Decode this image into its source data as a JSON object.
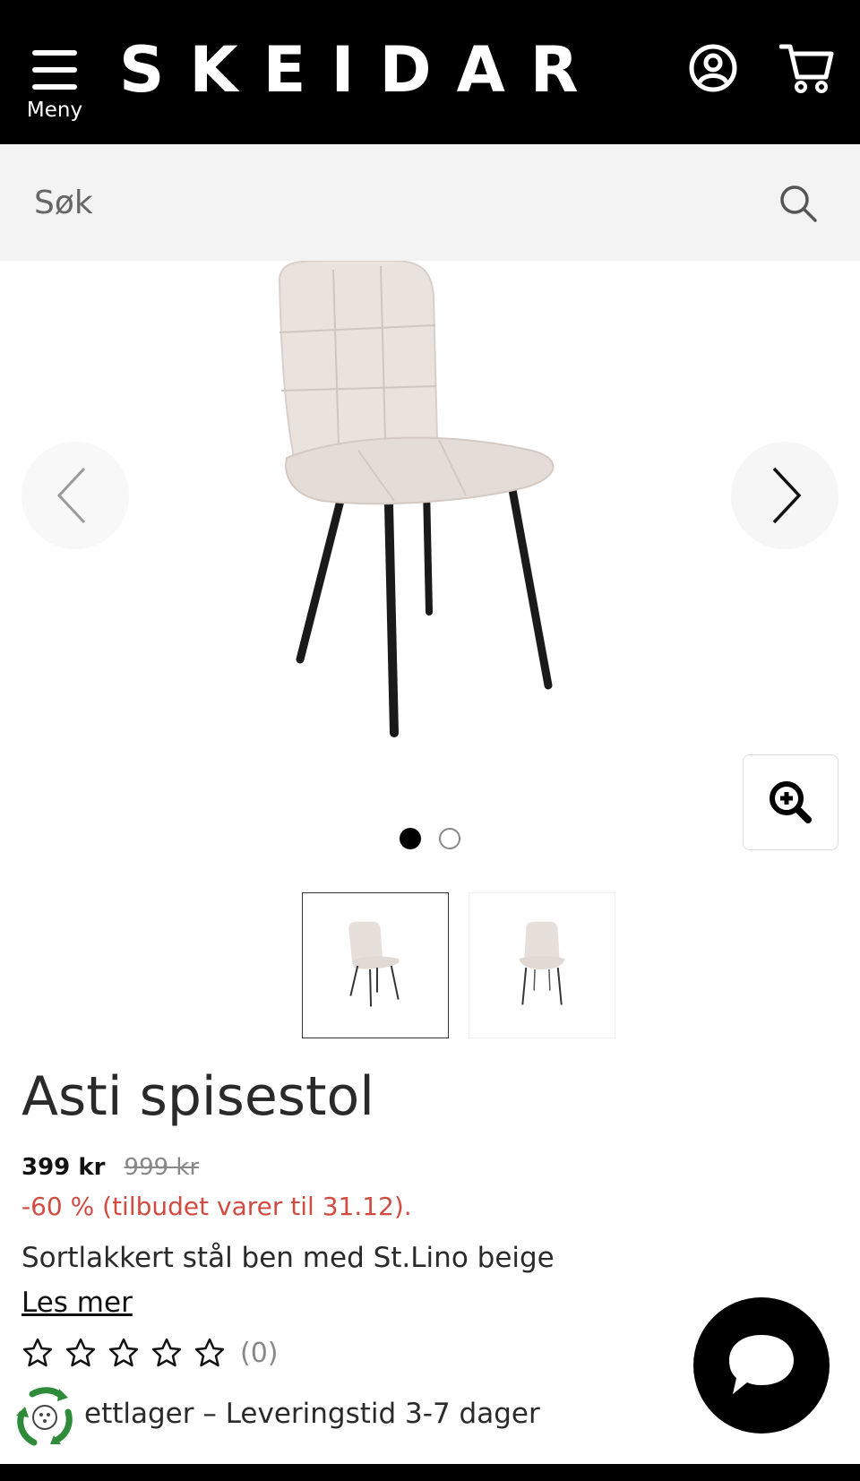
{
  "header": {
    "menu_label": "Meny",
    "logo_text": "SKEIDAR",
    "icons": [
      "hamburger-icon",
      "account-icon",
      "cart-icon"
    ]
  },
  "search": {
    "placeholder": "Søk",
    "icon": "search-icon"
  },
  "gallery": {
    "image_alt": "Asti spisestol",
    "slide_count": 2,
    "active_slide": 1,
    "icons": [
      "chevron-left-icon",
      "chevron-right-icon",
      "zoom-in-icon"
    ]
  },
  "product": {
    "title": "Asti spisestol",
    "price": "399 kr",
    "old_price": "999 kr",
    "discount": "-60 % (tilbudet varer til 31.12).",
    "description": "Sortlakkert stål ben med St.Lino beige",
    "read_more": "Les mer",
    "rating": 0,
    "rating_max": 5,
    "review_count": "(0)",
    "stock": "ettlager – Leveringstid 3-7 dager"
  },
  "colors": {
    "header_bg": "#000000",
    "search_bg": "#f3f3f3",
    "discount": "#d24b41",
    "fabric": "#e8e1dc",
    "eco_green": "#2e8b3a"
  }
}
